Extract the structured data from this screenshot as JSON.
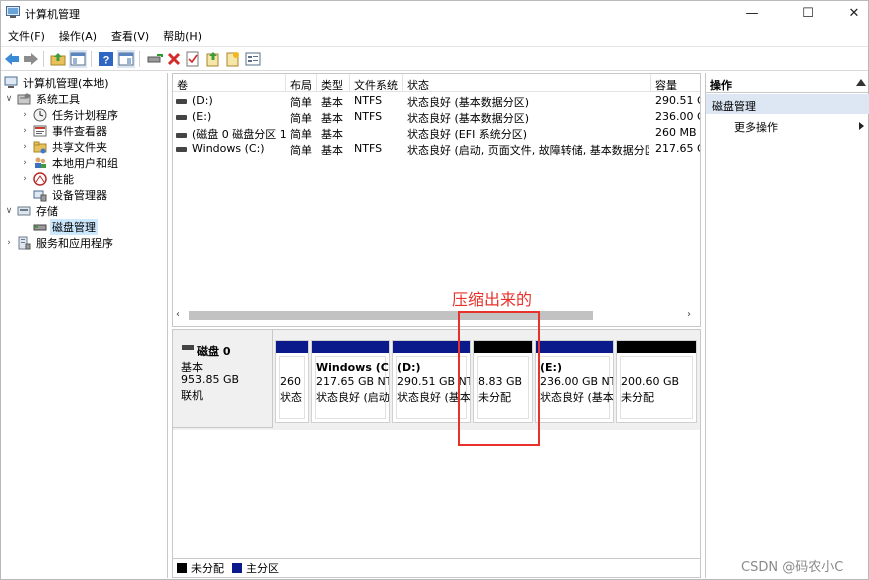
{
  "window": {
    "title": "计算机管理",
    "min_glyph": "—",
    "max_glyph": "☐",
    "close_glyph": "✕"
  },
  "menu": [
    "文件(F)",
    "操作(A)",
    "查看(V)",
    "帮助(H)"
  ],
  "tree": {
    "root": "计算机管理(本地)",
    "system_tools": "系统工具",
    "task_scheduler": "任务计划程序",
    "event_viewer": "事件查看器",
    "shared_folders": "共享文件夹",
    "local_users": "本地用户和组",
    "performance": "性能",
    "device_manager": "设备管理器",
    "storage": "存储",
    "disk_management": "磁盘管理",
    "services": "服务和应用程序"
  },
  "volume_table": {
    "headers": [
      "卷",
      "布局",
      "类型",
      "文件系统",
      "状态",
      "容量"
    ],
    "rows": [
      [
        "(D:)",
        "简单",
        "基本",
        "NTFS",
        "状态良好 (基本数据分区)",
        "290.51 G"
      ],
      [
        "(E:)",
        "简单",
        "基本",
        "NTFS",
        "状态良好 (基本数据分区)",
        "236.00 G"
      ],
      [
        "(磁盘 0 磁盘分区 1)",
        "简单",
        "基本",
        "",
        "状态良好 (EFI 系统分区)",
        "260 MB"
      ],
      [
        "Windows (C:)",
        "简单",
        "基本",
        "NTFS",
        "状态良好 (启动, 页面文件, 故障转储, 基本数据分区)",
        "217.65 G"
      ]
    ]
  },
  "disk0": {
    "name": "磁盘 0",
    "type": "基本",
    "size": "953.85 GB",
    "status": "联机"
  },
  "partitions": [
    {
      "title": "",
      "size": "260",
      "status": "状态",
      "kind": "primary"
    },
    {
      "title": "Windows (C",
      "size": "217.65 GB NT",
      "status": "状态良好 (启动",
      "kind": "primary"
    },
    {
      "title": "(D:)",
      "size": "290.51 GB NT",
      "status": "状态良好 (基本",
      "kind": "primary"
    },
    {
      "title": "",
      "size": "8.83 GB",
      "status": "未分配",
      "kind": "unallocated"
    },
    {
      "title": "(E:)",
      "size": "236.00 GB NT",
      "status": "状态良好 (基本",
      "kind": "primary"
    },
    {
      "title": "",
      "size": "200.60 GB",
      "status": "未分配",
      "kind": "unallocated"
    }
  ],
  "legend": {
    "unallocated": "未分配",
    "primary": "主分区"
  },
  "actions": {
    "header": "操作",
    "group": "磁盘管理",
    "more": "更多操作"
  },
  "annotation": {
    "text": "压缩出来的"
  },
  "watermark": "CSDN @码农小C",
  "colors": {
    "primary_bar": "#0b1a8a",
    "unallocated_bar": "#000000",
    "annotation": "#e8312b",
    "selection": "#cce8ff",
    "action_group_bg": "#dde7f3"
  }
}
